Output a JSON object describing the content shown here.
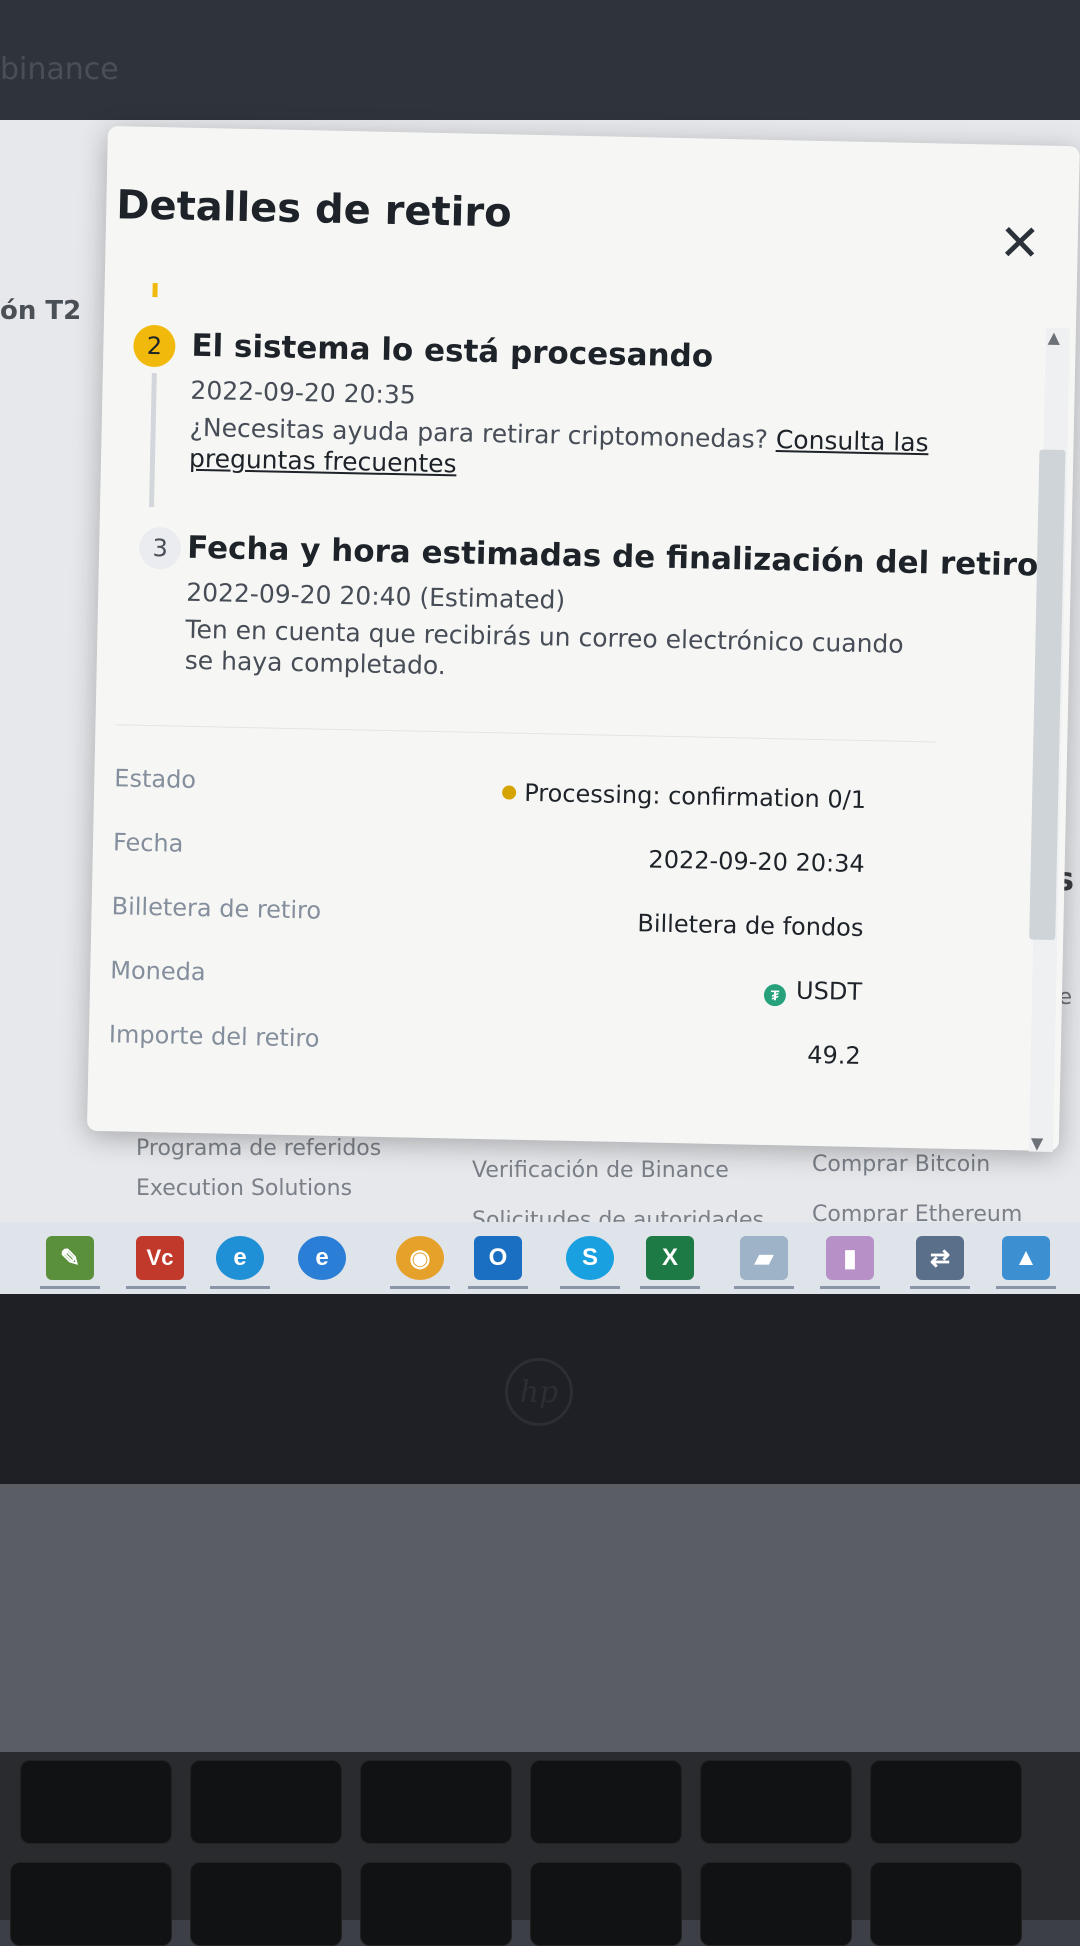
{
  "background": {
    "brand": "binance",
    "left_fragment": "ón T2",
    "right_fragment_mas": "ás",
    "right_fragment_text": "os de",
    "footer_links": [
      "Programa de referidos",
      "Execution Solutions",
      "Verificación de Binance",
      "Solicitudes de autoridades",
      "Comprar Bitcoin",
      "Comprar Ethereum"
    ]
  },
  "modal": {
    "title": "Detalles de retiro",
    "close_icon": "close-icon",
    "steps": [
      {
        "number": "2",
        "title": "El sistema lo está procesando",
        "time": "2022-09-20 20:35",
        "desc_prefix": "¿Necesitas ayuda para retirar criptomonedas? ",
        "link_text": "Consulta las preguntas frecuentes"
      },
      {
        "number": "3",
        "title": "Fecha y hora estimadas de finalización del retiro",
        "time": "2022-09-20 20:40 (Estimated)",
        "desc": "Ten en cuenta que recibirás un correo electrónico cuando se haya completado."
      }
    ],
    "details": [
      {
        "label": "Estado",
        "value": "Processing: confirmation 0/1"
      },
      {
        "label": "Fecha",
        "value": "2022-09-20 20:34"
      },
      {
        "label": "Billetera de retiro",
        "value": "Billetera de fondos"
      },
      {
        "label": "Moneda",
        "value": "USDT"
      },
      {
        "label": "Importe del retiro",
        "value": "49.2"
      }
    ],
    "status_color": "#d6a400",
    "coin_color": "#26a17b"
  },
  "taskbar": {
    "icons": [
      "notepad-icon",
      "visual-studio-icon",
      "edge-icon",
      "internet-explorer-icon",
      "chrome-icon",
      "outlook-icon",
      "skype-icon",
      "excel-icon",
      "file-manager-icon",
      "app-icon",
      "network-icon",
      "photos-icon"
    ]
  }
}
